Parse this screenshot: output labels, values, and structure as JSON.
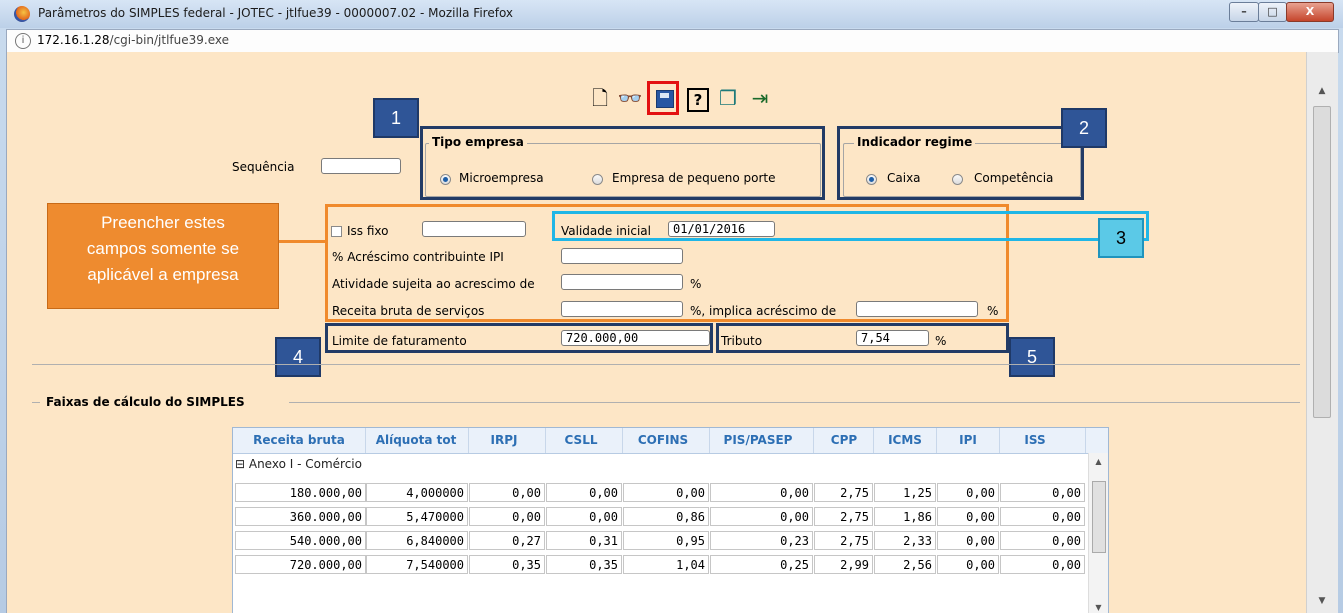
{
  "window": {
    "title": "Parâmetros do SIMPLES federal - JOTEC - jtlfue39 - 0000007.02 - Mozilla Firefox",
    "min": "–",
    "max": "□",
    "close": "X"
  },
  "urlbar": {
    "host": "172.16.1.28",
    "path": "/cgi-bin/jtlfue39.exe"
  },
  "form": {
    "sequencia_label": "Sequência",
    "sequencia_value": "",
    "tipo_empresa": {
      "legend": "Tipo empresa",
      "opt1": "Microempresa",
      "opt2": "Empresa de pequeno porte",
      "selected": "Microempresa"
    },
    "indicador_regime": {
      "legend": "Indicador regime",
      "opt1": "Caixa",
      "opt2": "Competência",
      "selected": "Caixa"
    },
    "iss_fixo_label": "Iss fixo",
    "iss_fixo_value": "",
    "validade_label": "Validade inicial",
    "validade_value": "01/01/2016",
    "acrescimo_ipi_label": "% Acréscimo contribuinte IPI",
    "atividade_label": "Atividade sujeita ao acrescimo de",
    "pct": "%",
    "receita_label": "Receita bruta de serviços",
    "implica_label": "%, implica acréscimo de",
    "limite_label": "Limite de faturamento",
    "limite_value": "720.000,00",
    "tributo_label": "Tributo",
    "tributo_value": "7,54"
  },
  "callout": {
    "line1": "Preencher estes",
    "line2": "campos somente se",
    "line3": "aplicável a empresa"
  },
  "badges": {
    "b1": "1",
    "b2": "2",
    "b3": "3",
    "b4": "4",
    "b5": "5"
  },
  "faixas": {
    "legend": "Faixas de cálculo do SIMPLES",
    "columns": [
      "Receita bruta",
      "Alíquota tot",
      "IRPJ",
      "CSLL",
      "COFINS",
      "PIS/PASEP",
      "CPP",
      "ICMS",
      "IPI",
      "ISS"
    ],
    "group": "⊟ Anexo I  -  Comércio",
    "rows": [
      [
        "180.000,00",
        "4,000000",
        "0,00",
        "0,00",
        "0,00",
        "0,00",
        "2,75",
        "1,25",
        "0,00",
        "0,00"
      ],
      [
        "360.000,00",
        "5,470000",
        "0,00",
        "0,00",
        "0,86",
        "0,00",
        "2,75",
        "1,86",
        "0,00",
        "0,00"
      ],
      [
        "540.000,00",
        "6,840000",
        "0,27",
        "0,31",
        "0,95",
        "0,23",
        "2,75",
        "2,33",
        "0,00",
        "0,00"
      ],
      [
        "720.000,00",
        "7,540000",
        "0,35",
        "0,35",
        "1,04",
        "0,25",
        "2,99",
        "2,56",
        "0,00",
        "0,00"
      ]
    ]
  }
}
